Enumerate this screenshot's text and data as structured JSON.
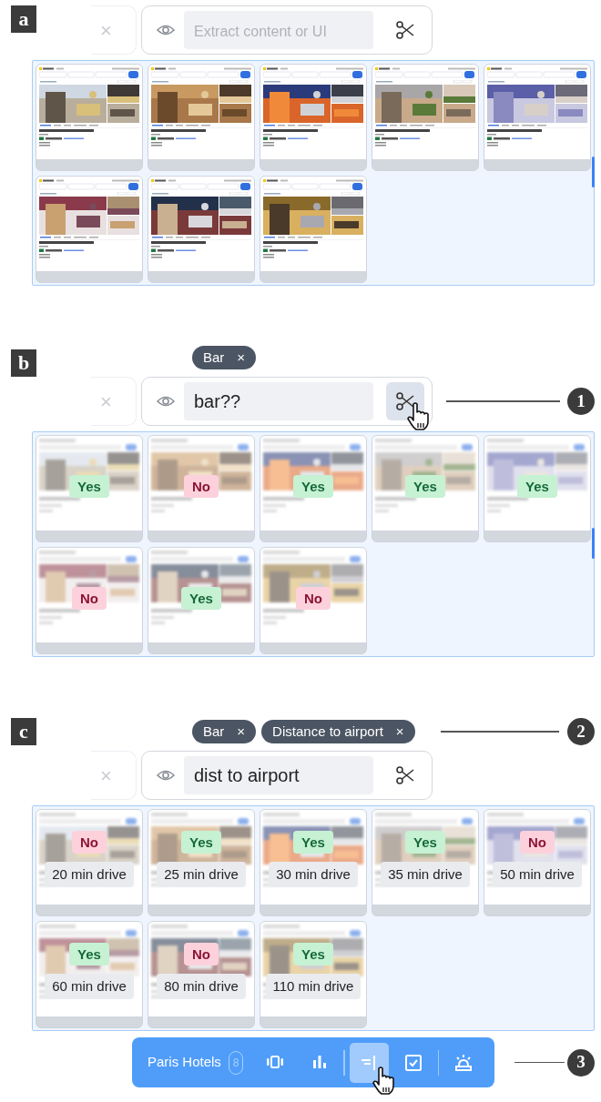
{
  "panels": [
    {
      "label": "a",
      "kind": "preview",
      "close_glyph": "×",
      "search": {
        "placeholder": "Extract content or UI",
        "scissors_pressed": false,
        "cursor": false
      },
      "scrollbar": true,
      "results": [
        {
          "kind": "page"
        },
        {
          "kind": "page"
        },
        {
          "kind": "page"
        },
        {
          "kind": "page"
        },
        {
          "kind": "page"
        },
        {
          "kind": "page"
        },
        {
          "kind": "page"
        },
        {
          "kind": "page"
        }
      ]
    },
    {
      "label": "b",
      "kind": "answers",
      "chips": [
        {
          "text": "Bar",
          "remove": "×"
        }
      ],
      "close_glyph": "×",
      "search": {
        "value": "bar??",
        "scissors_pressed": true,
        "cursor": true,
        "callout": "1"
      },
      "scrollbar": true,
      "results": [
        {
          "answer": "Yes",
          "positive": true
        },
        {
          "answer": "No",
          "positive": false
        },
        {
          "answer": "Yes",
          "positive": true
        },
        {
          "answer": "Yes",
          "positive": true
        },
        {
          "answer": "Yes",
          "positive": true
        },
        {
          "answer": "No",
          "positive": false
        },
        {
          "answer": "Yes",
          "positive": true
        },
        {
          "answer": "No",
          "positive": false
        }
      ]
    },
    {
      "label": "c",
      "kind": "answers",
      "chips": [
        {
          "text": "Bar",
          "remove": "×"
        },
        {
          "text": "Distance to airport",
          "remove": "×"
        }
      ],
      "chips_callout": "2",
      "close_glyph": "×",
      "search": {
        "value": "dist to airport",
        "scissors_pressed": false,
        "cursor": false
      },
      "scrollbar": false,
      "results": [
        {
          "answer": "No",
          "positive": false,
          "distance": "20 min drive"
        },
        {
          "answer": "Yes",
          "positive": true,
          "distance": "25 min drive"
        },
        {
          "answer": "Yes",
          "positive": true,
          "distance": "30 min drive"
        },
        {
          "answer": "Yes",
          "positive": true,
          "distance": "35 min drive"
        },
        {
          "answer": "No",
          "positive": false,
          "distance": "50 min drive"
        },
        {
          "answer": "Yes",
          "positive": true,
          "distance": "60 min drive"
        },
        {
          "answer": "No",
          "positive": false,
          "distance": "80 min drive"
        },
        {
          "answer": "Yes",
          "positive": true,
          "distance": "110 min drive"
        }
      ]
    }
  ],
  "toolbar": {
    "title": "Paris Hotels",
    "count": "8",
    "callout": "3",
    "tools": [
      {
        "kind": "carousel",
        "selected": false,
        "divider_before": false,
        "cursor": false
      },
      {
        "kind": "chart",
        "selected": false,
        "divider_before": false,
        "cursor": false
      },
      {
        "kind": "column",
        "selected": true,
        "divider_before": true,
        "cursor": true
      },
      {
        "kind": "check",
        "selected": false,
        "divider_before": false,
        "cursor": false
      },
      {
        "kind": "alarm",
        "selected": false,
        "divider_before": true,
        "cursor": false
      }
    ]
  }
}
